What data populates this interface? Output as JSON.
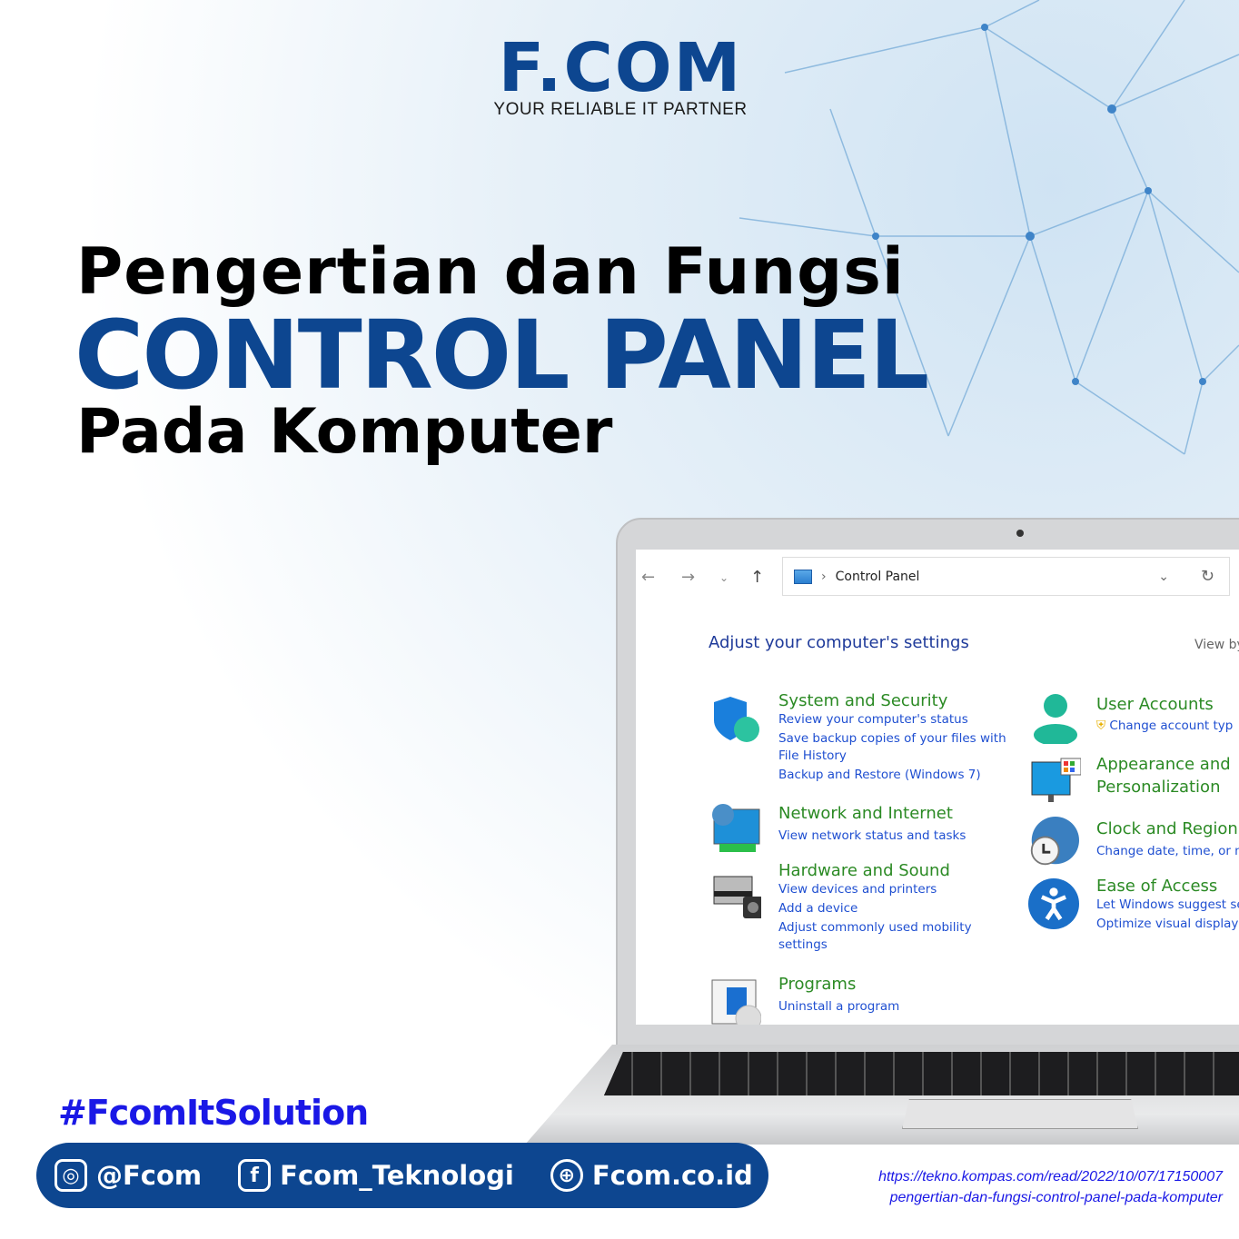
{
  "logo": {
    "name": "F.COM",
    "tagline": "YOUR RELIABLE IT PARTNER"
  },
  "headline": {
    "line1": "Pengertian dan Fungsi",
    "line2": "CONTROL PANEL",
    "line3": "Pada Komputer"
  },
  "colors": {
    "brand": "#0d4690",
    "hashtag": "#1a18e6",
    "category_title": "#2b8a24",
    "link": "#1f4fd1"
  },
  "control_panel": {
    "address": "Control Panel",
    "heading": "Adjust your computer's settings",
    "view_by": "View by",
    "left": [
      {
        "title": "System and Security",
        "icon": "shield-icon",
        "links": [
          "Review your computer's status",
          "Save backup copies of your files with",
          "File History",
          "Backup and Restore (Windows 7)"
        ]
      },
      {
        "title": "Network and Internet",
        "icon": "network-icon",
        "links": [
          "View network status and tasks"
        ]
      },
      {
        "title": "Hardware and Sound",
        "icon": "printer-icon",
        "links": [
          "View devices and printers",
          "Add a device",
          "Adjust commonly used mobility",
          "settings"
        ]
      },
      {
        "title": "Programs",
        "icon": "programs-icon",
        "links": [
          "Uninstall a program"
        ]
      }
    ],
    "right": [
      {
        "title": "User Accounts",
        "icon": "user-icon",
        "links": [
          "Change account typ"
        ]
      },
      {
        "title": "Appearance and",
        "title2": "Personalization",
        "icon": "monitor-icon",
        "links": []
      },
      {
        "title": "Clock and Region",
        "icon": "clock-globe-icon",
        "links": [
          "Change date, time, or n"
        ]
      },
      {
        "title": "Ease of Access",
        "icon": "accessibility-icon",
        "links": [
          "Let Windows suggest se",
          "Optimize visual display"
        ]
      }
    ]
  },
  "hashtag": "#FcomItSolution",
  "social": [
    {
      "icon": "instagram-icon",
      "label": "@Fcom"
    },
    {
      "icon": "facebook-icon",
      "label": "Fcom_Teknologi"
    },
    {
      "icon": "globe-icon",
      "label": "Fcom.co.id"
    }
  ],
  "source": {
    "line1": "https://tekno.kompas.com/read/2022/10/07/17150007",
    "line2": "pengertian-dan-fungsi-control-panel-pada-komputer"
  }
}
